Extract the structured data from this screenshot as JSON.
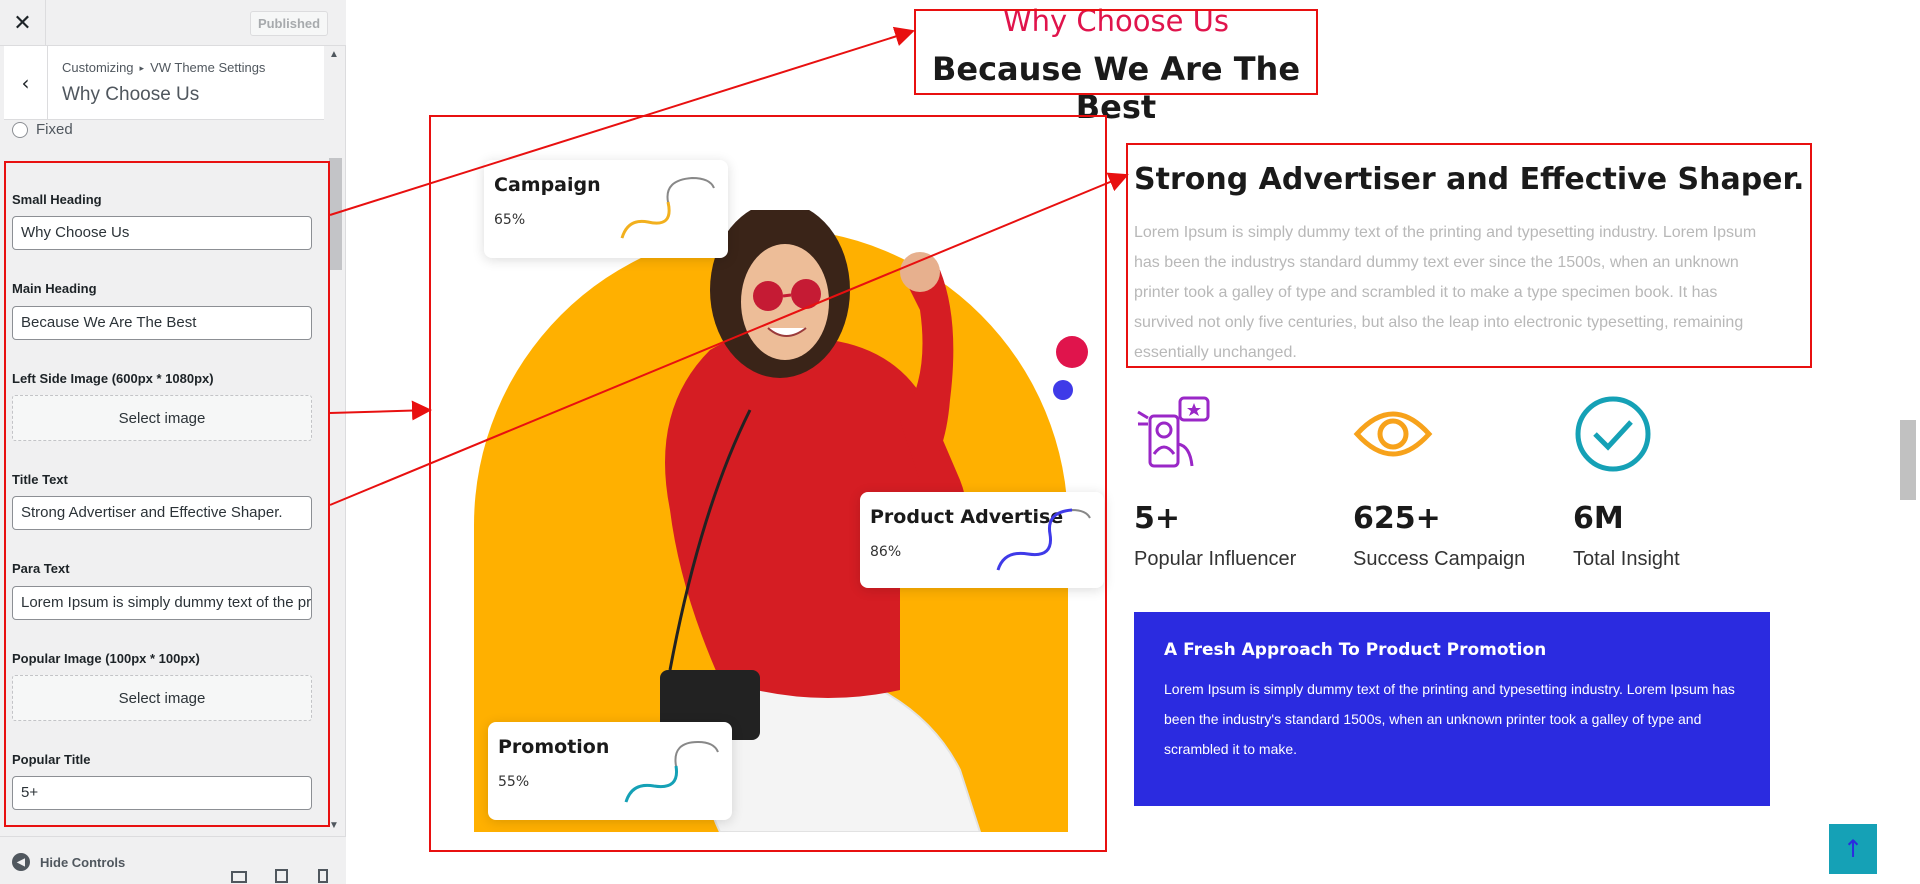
{
  "customizer": {
    "close_glyph": "✕",
    "publish_label": "Published",
    "back_glyph": "‹",
    "breadcrumb": {
      "root": "Customizing",
      "separator": "▸",
      "parent": "VW Theme Settings"
    },
    "section_title": "Why Choose Us",
    "radio_option": "Fixed",
    "fields": {
      "small_heading": {
        "label": "Small Heading",
        "value": "Why Choose Us"
      },
      "main_heading": {
        "label": "Main Heading",
        "value": "Because We Are The Best"
      },
      "left_image": {
        "label": "Left Side Image (600px * 1080px)",
        "button": "Select image"
      },
      "title_text": {
        "label": "Title Text",
        "value": "Strong Advertiser and Effective Shaper."
      },
      "para_text": {
        "label": "Para Text",
        "value": "Lorem Ipsum is simply dummy text of the printing"
      },
      "popular_image": {
        "label": "Popular Image (100px * 100px)",
        "button": "Select image"
      },
      "popular_title": {
        "label": "Popular Title",
        "value": "5+"
      }
    },
    "hide_controls": "Hide Controls",
    "hide_icon_glyph": "◀"
  },
  "preview": {
    "small_heading": "Why Choose Us",
    "main_heading": "Because We Are The Best",
    "cards": {
      "campaign": {
        "title": "Campaign",
        "value": "65%"
      },
      "product": {
        "title": "Product Advertise",
        "value": "86%"
      },
      "promotion": {
        "title": "Promotion",
        "value": "55%"
      }
    },
    "title_text": "Strong Advertiser and Effective Shaper.",
    "para_text": "Lorem Ipsum is simply dummy text of the printing and typesetting industry. Lorem Ipsum has been the industrys standard dummy text ever since the 1500s, when an unknown printer took a galley of type and scrambled it to make a type specimen book. It has survived not only five centuries, but also the leap into electronic typesetting, remaining essentially unchanged.",
    "features": [
      {
        "number": "5+",
        "label": "Popular Influencer",
        "icon": "influencer-icon"
      },
      {
        "number": "625+",
        "label": "Success Campaign",
        "icon": "eye-icon"
      },
      {
        "number": "6M",
        "label": "Total Insight",
        "icon": "check-circle-icon"
      }
    ],
    "promo": {
      "title": "A Fresh Approach To Product Promotion",
      "text": "Lorem Ipsum is simply dummy text of the printing and typesetting industry. Lorem Ipsum has been the industry's standard 1500s, when an unknown printer took a galley of type and scrambled it to make."
    },
    "back_to_top_glyph": "↑"
  },
  "colors": {
    "accent_red": "#e0144c",
    "brand_blue": "#2b2be0",
    "orange": "#ffb000",
    "teal": "#15a1b6",
    "annotation": "#e81010"
  }
}
